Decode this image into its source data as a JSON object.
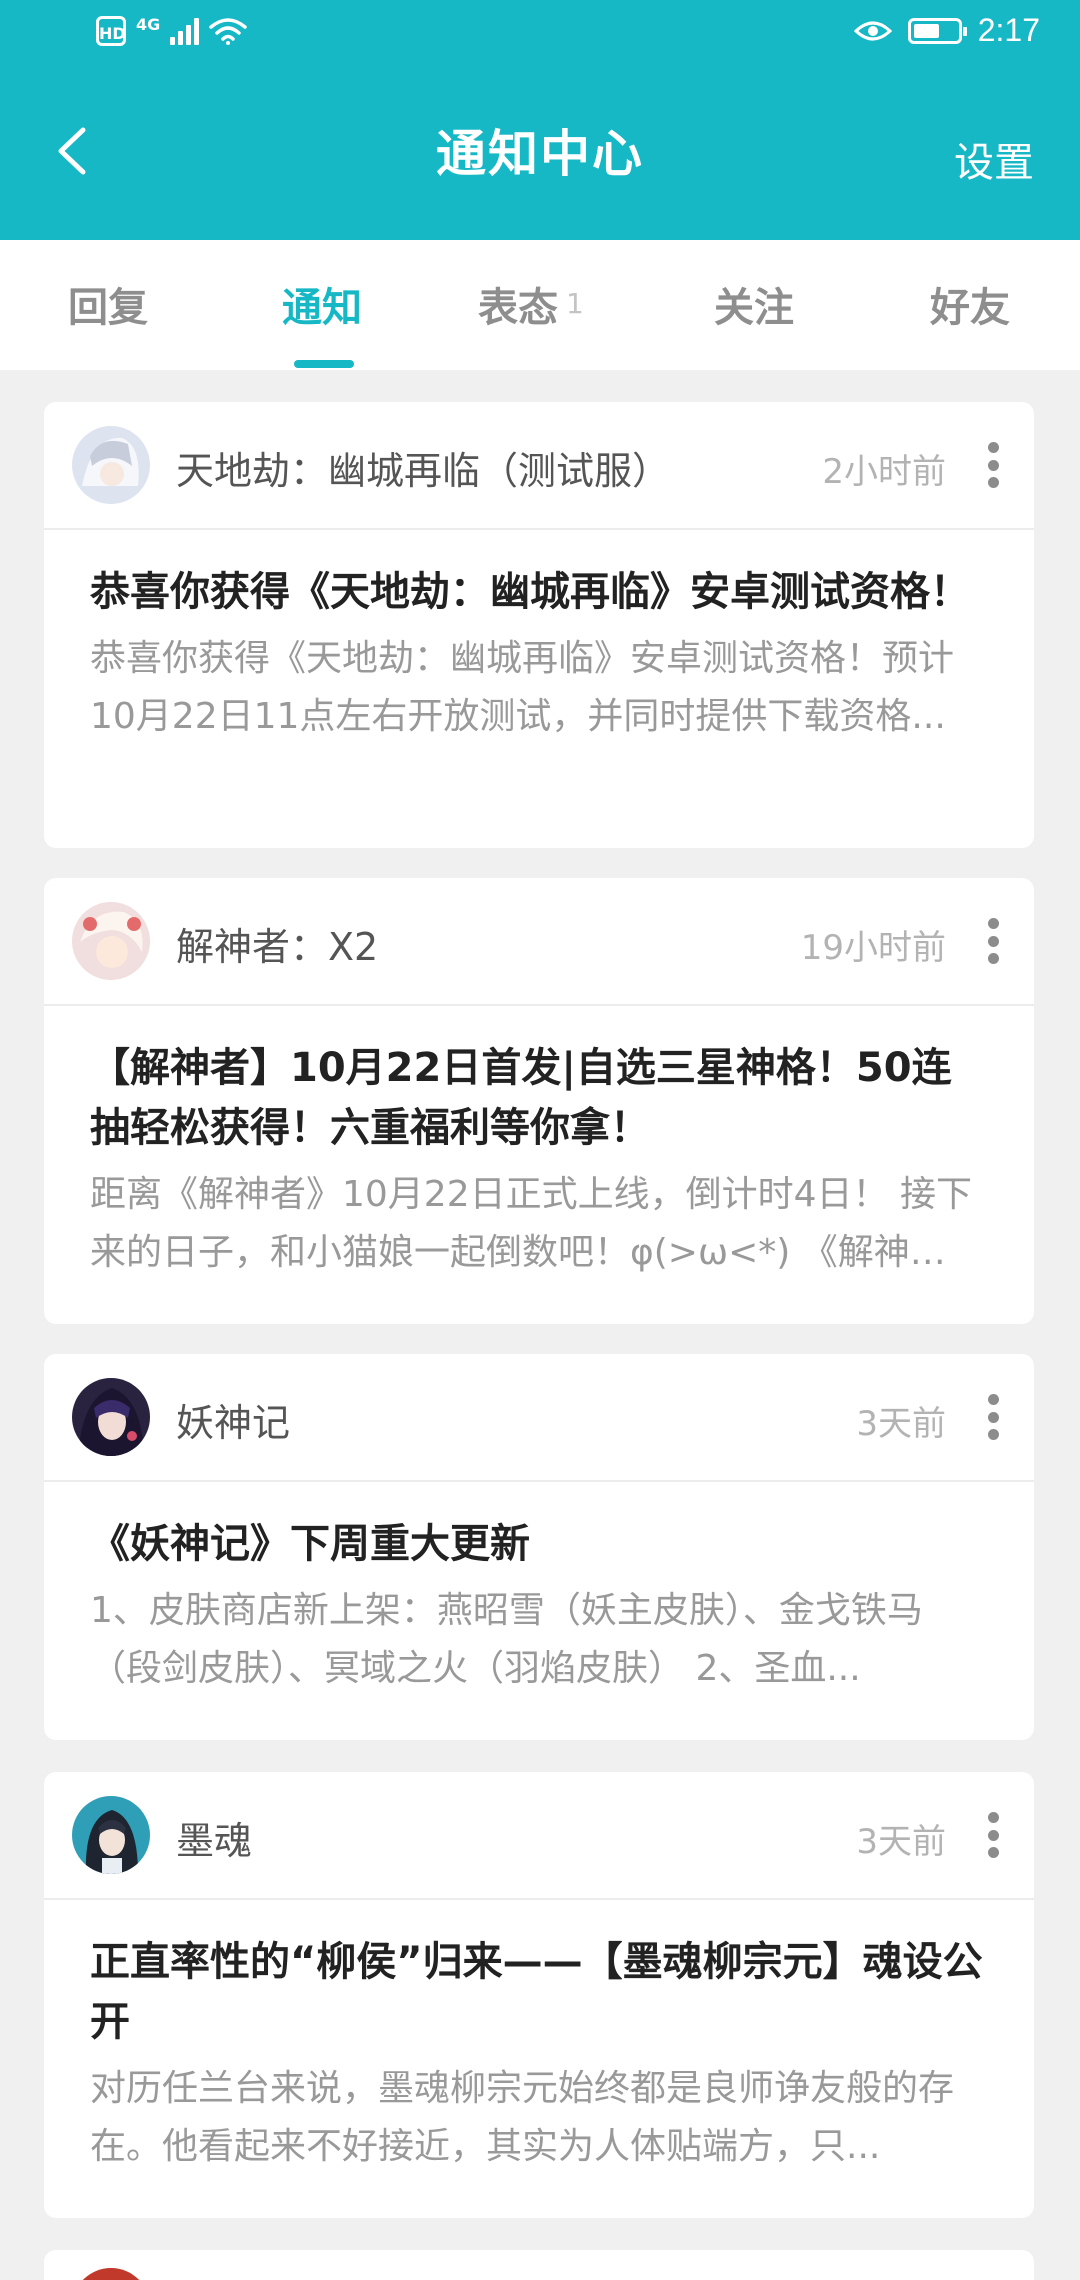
{
  "status_bar": {
    "hd": "HD",
    "network": "4G",
    "time": "2:17",
    "battery_level": 0.6
  },
  "app_bar": {
    "title": "通知中心",
    "settings_label": "设置"
  },
  "tabs": [
    {
      "label": "回复",
      "badge": ""
    },
    {
      "label": "通知",
      "badge": ""
    },
    {
      "label": "表态",
      "badge": "1"
    },
    {
      "label": "关注",
      "badge": ""
    },
    {
      "label": "好友",
      "badge": ""
    }
  ],
  "notifications": [
    {
      "source": "天地劫：幽城再临（测试服）",
      "time_ago": "2小时前",
      "headline": "恭喜你获得《天地劫：幽城再临》安卓测试资格！",
      "excerpt": "恭喜你获得《天地劫：幽城再临》安卓测试资格！预计10月22日11点左右开放测试，并同时提供下载资格...",
      "avatar_color": "#dde3ef"
    },
    {
      "source": "解神者：X2",
      "time_ago": "19小时前",
      "headline": "【解神者】10月22日首发|自选三星神格！50连抽轻松获得！六重福利等你拿！",
      "excerpt": "距离《解神者》10月22日正式上线，倒计时4日！ 接下来的日子，和小猫娘一起倒数吧！φ(>ω<*) 《解神者》...",
      "avatar_color": "#f1dede"
    },
    {
      "source": "妖神记",
      "time_ago": "3天前",
      "headline": "《妖神记》下周重大更新",
      "excerpt": "1、皮肤商店新上架：燕昭雪（妖主皮肤）、金戈铁马（段剑皮肤）、冥域之火（羽焰皮肤） 2、圣血...",
      "avatar_color": "#2a2340"
    },
    {
      "source": "墨魂",
      "time_ago": "3天前",
      "headline": "正直率性的“柳侯”归来——【墨魂柳宗元】魂设公开",
      "excerpt": "对历任兰台来说，墨魂柳宗元始终都是良师诤友般的存在。他看起来不好接近，其实为人体贴端方，只...",
      "avatar_color": "#2f9fb8"
    }
  ]
}
